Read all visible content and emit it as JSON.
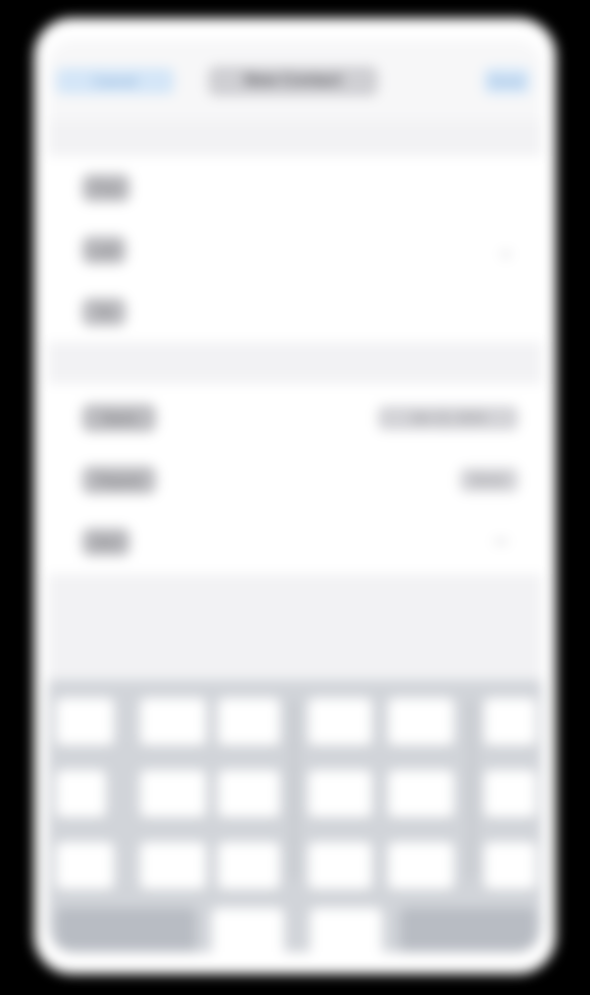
{
  "navbar": {
    "left_button": "Cancel",
    "title": "New Contact",
    "right_button": "Done"
  },
  "section_contact": {
    "rows": [
      {
        "label": "First",
        "value": ""
      },
      {
        "label": "Last",
        "value": ""
      },
      {
        "label": "Tel",
        "value": ""
      }
    ]
  },
  "section_event": {
    "rows": [
      {
        "label": "Starts",
        "value": "Jan 12, 2024"
      },
      {
        "label": "Repeat",
        "value": "Never"
      },
      {
        "label": "Alert",
        "value": ""
      }
    ]
  },
  "keyboard": {
    "rows": [
      [
        "",
        "",
        "",
        "",
        "",
        ""
      ],
      [
        "",
        "",
        "",
        "",
        "",
        ""
      ],
      [
        "",
        "",
        "",
        "",
        "",
        ""
      ]
    ],
    "bottom": [
      "",
      "",
      "",
      ""
    ]
  },
  "colors": {
    "accent": "#007aff",
    "background": "#f2f2f4",
    "keyboard": "#d1d4d9"
  },
  "icons": [
    "chevron-down-icon"
  ]
}
